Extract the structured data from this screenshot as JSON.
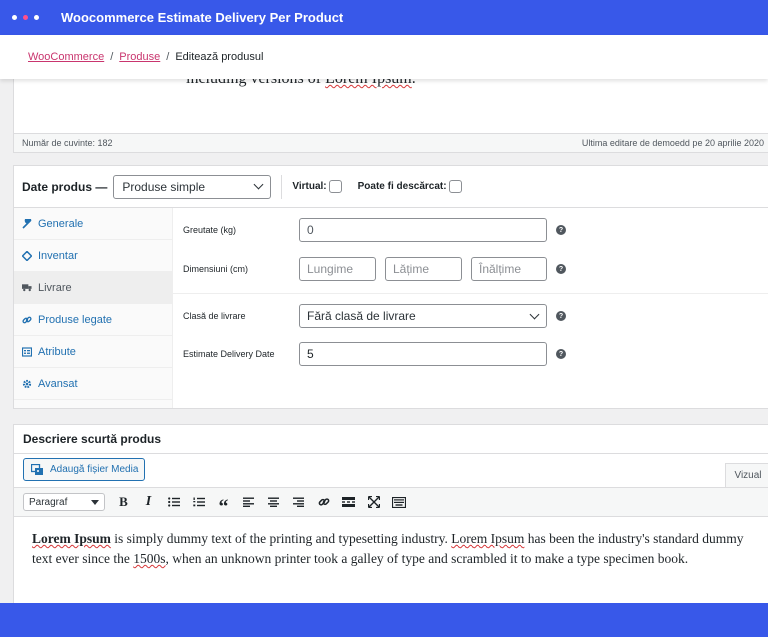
{
  "app": {
    "title": "Woocommerce Estimate Delivery Per Product",
    "dot_colors": [
      "#ffffff",
      "#ff4f8b",
      "#ffffff"
    ]
  },
  "breadcrumb": {
    "items": [
      "WooCommerce",
      "Produse"
    ],
    "current": "Editează produsul"
  },
  "editor": {
    "cut_text_a": "including versions of ",
    "cut_text_b": "Lorem Ipsum",
    "cut_text_c": ".",
    "word_count": "Număr de cuvinte: 182",
    "last_edit": "Ultima editare de demoedd pe 20 aprilie 2020"
  },
  "product_data": {
    "title": "Date produs —",
    "type_value": "Produse simple",
    "virtual_label": "Virtual:",
    "download_label": "Poate fi descărcat:",
    "tabs": [
      {
        "label": "Generale",
        "icon": "wrench-icon"
      },
      {
        "label": "Inventar",
        "icon": "tag-icon"
      },
      {
        "label": "Livrare",
        "icon": "truck-icon"
      },
      {
        "label": "Produse legate",
        "icon": "link-icon"
      },
      {
        "label": "Atribute",
        "icon": "list-icon"
      },
      {
        "label": "Avansat",
        "icon": "gear-icon"
      }
    ],
    "active_tab": "Livrare",
    "weight_label": "Greutate (kg)",
    "weight_value": "0",
    "dims_label": "Dimensiuni (cm)",
    "length_placeholder": "Lungime",
    "width_placeholder": "Lățime",
    "height_placeholder": "Înălțime",
    "shipping_class_label": "Clasă de livrare",
    "shipping_class_value": "Fără clasă de livrare",
    "delivery_label": "Estimate Delivery Date",
    "delivery_value": "5",
    "help_glyph": "?"
  },
  "short_description": {
    "title": "Descriere scurtă produs",
    "add_media": "Adaugă fișier Media",
    "visual_tab": "Vizual",
    "format_value": "Paragraf",
    "toolbar_icons": [
      "bold-icon",
      "italic-icon",
      "bullet-list-icon",
      "numbered-list-icon",
      "blockquote-icon",
      "align-left-icon",
      "align-center-icon",
      "align-right-icon",
      "link-icon",
      "read-more-icon",
      "fullscreen-icon",
      "keyboard-icon"
    ],
    "line1": {
      "lead": "Lorem Ipsum",
      "a": " is simply dummy text of the printing and typesetting industry. ",
      "b": "Lorem Ipsum",
      "c": " has been the industry's standard dummy"
    },
    "line2": {
      "a": "text ever since the ",
      "b": "1500s",
      "c": ", when an unknown printer took a galley of type and scrambled it to make a type specimen book."
    }
  }
}
